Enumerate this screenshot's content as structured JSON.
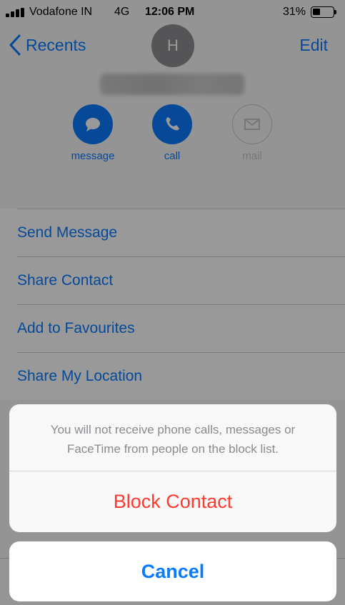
{
  "status_bar": {
    "carrier": "Vodafone IN",
    "network": "4G",
    "time": "12:06 PM",
    "battery_percent": "31%",
    "battery_level": 0.31
  },
  "nav": {
    "back_label": "Recents",
    "edit_label": "Edit",
    "avatar_initial": "H"
  },
  "contact": {
    "name_blurred": ""
  },
  "actions": [
    {
      "label": "message",
      "icon": "message-bubble-icon",
      "enabled": true
    },
    {
      "label": "call",
      "icon": "phone-icon",
      "enabled": true
    },
    {
      "label": "mail",
      "icon": "envelope-icon",
      "enabled": false
    }
  ],
  "options": [
    "Send Message",
    "Share Contact",
    "Add to Favourites",
    "Share My Location"
  ],
  "action_sheet": {
    "message": "You will not receive phone calls, messages or FaceTime from people on the block list.",
    "block_label": "Block Contact",
    "cancel_label": "Cancel"
  },
  "colors": {
    "accent": "#0a7aff",
    "destructive": "#ff3b30",
    "avatar": "#8e8e93"
  }
}
